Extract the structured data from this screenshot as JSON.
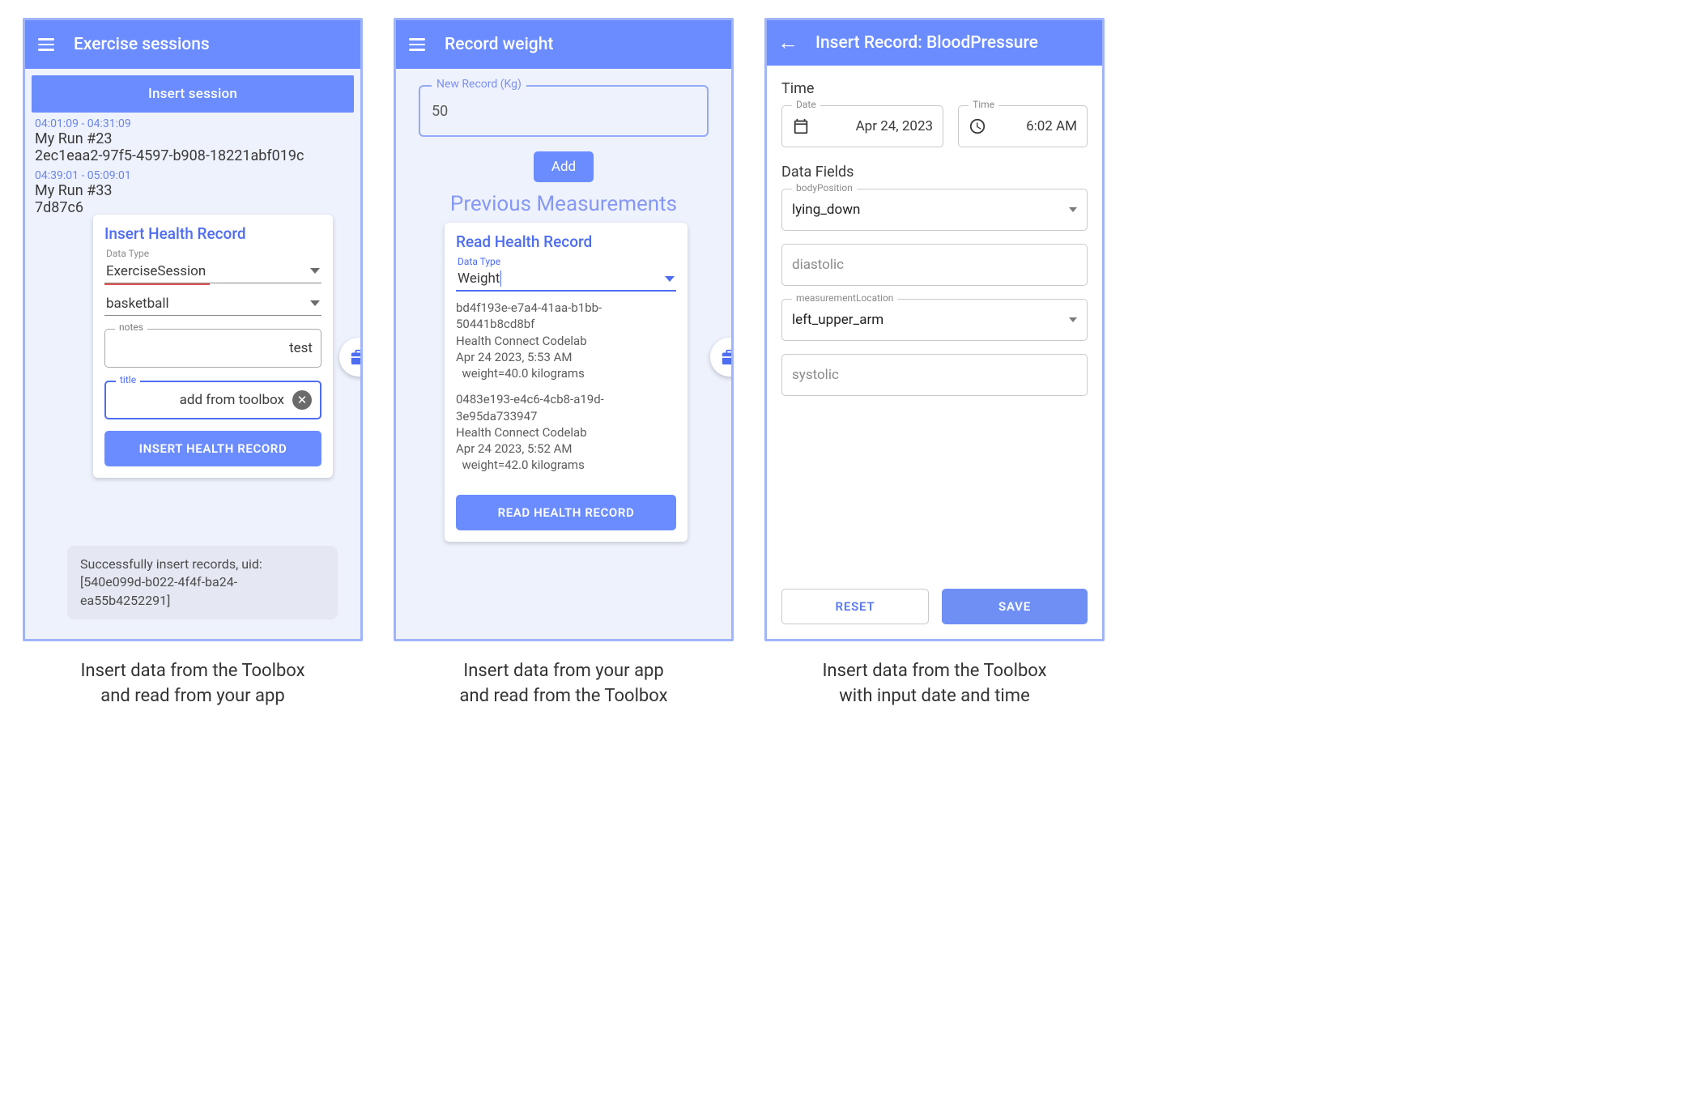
{
  "panel1": {
    "appbar_title": "Exercise sessions",
    "insert_session_btn": "Insert session",
    "sessions": [
      {
        "time": "04:01:09 - 04:31:09",
        "name": "My Run #23",
        "uuid": "2ec1eaa2-97f5-4597-b908-18221abf019c"
      },
      {
        "time": "04:39:01 - 05:09:01",
        "name": "My Run #33",
        "uuid": "7d87c6"
      }
    ],
    "card": {
      "title": "Insert Health Record",
      "data_type_label": "Data Type",
      "data_type_value": "ExerciseSession",
      "exercise_type_value": "basketball",
      "notes_label": "notes",
      "notes_value": "test",
      "title_label": "title",
      "title_value": "add from toolbox",
      "button": "INSERT HEALTH RECORD"
    },
    "snackbar_line1": "Successfully insert records, uid:",
    "snackbar_line2": "[540e099d-b022-4f4f-ba24-ea55b4252291]",
    "caption_l1": "Insert data from the Toolbox",
    "caption_l2": "and read from your app"
  },
  "panel2": {
    "appbar_title": "Record weight",
    "weight_label": "New Record (Kg)",
    "weight_value": "50",
    "add_btn": "Add",
    "prev_title": "Previous Measurements",
    "card": {
      "title": "Read Health Record",
      "data_type_label": "Data Type",
      "data_type_value": "Weight",
      "button": "READ HEALTH RECORD"
    },
    "entries": [
      {
        "uuid": "bd4f193e-e7a4-41aa-b1bb-50441b8cd8bf",
        "source": "Health Connect Codelab",
        "ts": "Apr 24 2023, 5:53 AM",
        "value": "  weight=40.0 kilograms"
      },
      {
        "uuid": "0483e193-e4c6-4cb8-a19d-3e95da733947",
        "source": "Health Connect Codelab",
        "ts": "Apr 24 2023, 5:52 AM",
        "value": "  weight=42.0 kilograms"
      }
    ],
    "caption_l1": "Insert data from your app",
    "caption_l2": "and read from the Toolbox"
  },
  "panel3": {
    "appbar_title": "Insert Record: BloodPressure",
    "time_section": "Time",
    "date_label": "Date",
    "date_value": "Apr 24, 2023",
    "time_label": "Time",
    "time_value": "6:02 AM",
    "data_fields_section": "Data Fields",
    "fields": {
      "bodyPosition_label": "bodyPosition",
      "bodyPosition_value": "lying_down",
      "diastolic_label": "diastolic",
      "measLoc_label": "measurementLocation",
      "measLoc_value": "left_upper_arm",
      "systolic_label": "systolic"
    },
    "reset": "RESET",
    "save": "SAVE",
    "caption_l1": "Insert data from the Toolbox",
    "caption_l2": "with input date and time"
  }
}
